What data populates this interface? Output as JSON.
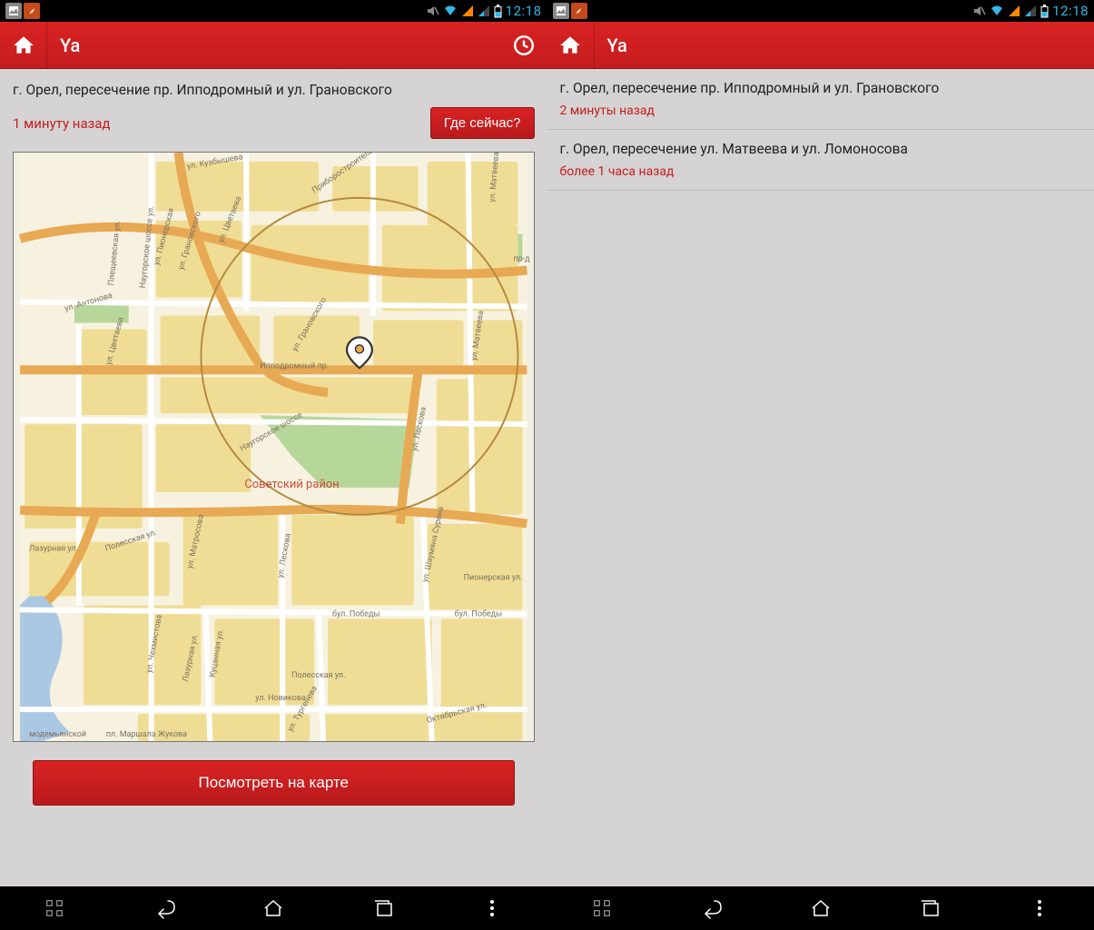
{
  "status": {
    "time": "12:18"
  },
  "appbar": {
    "title": "Ya"
  },
  "left": {
    "location": "г. Орел, пересечение пр. Ипподромный и ул. Грановского",
    "timeago": "1 минуту назад",
    "where_now_label": "Где сейчас?",
    "view_on_map_label": "Посмотреть на карте",
    "map": {
      "district": "Советский район",
      "streets": [
        "ул. Кузбышева",
        "ул. Пионерская",
        "ул. Цветаева",
        "Приборостроительная ул.",
        "ул. Матвеева",
        "ул. Матвеева",
        "пр-д",
        "Наугорское шоссе ул.",
        "Плещеевская ул.",
        "ул. Грановского",
        "ул. Антонова",
        "ул. Цветаева",
        "ул. Грановского",
        "Ипподромный пр.",
        "Наугорское шоссе",
        "ул. Лескова",
        "Полесская ул.",
        "ул. Матросова",
        "ул. Лескова",
        "ул. Шаумяна Сурена",
        "Пионерская ул.",
        "ул. Чехмистова",
        "Лазурная ул.",
        "Лазурная ул.",
        "Куцанная ул.",
        "ул. Новикова",
        "Полесская ул.",
        "Октябрьская ул.",
        "бул. Победы",
        "бул. Победы",
        "ул. Тургенева",
        "модемьянской",
        "пл. Маршала Жукова"
      ]
    }
  },
  "right": {
    "history": [
      {
        "addr": "г. Орел, пересечение пр. Ипподромный и ул. Грановского",
        "ago": "2 минуты назад"
      },
      {
        "addr": "г. Орел, пересечение ул. Матвеева и ул. Ломоносова",
        "ago": "более 1 часа назад"
      }
    ]
  }
}
